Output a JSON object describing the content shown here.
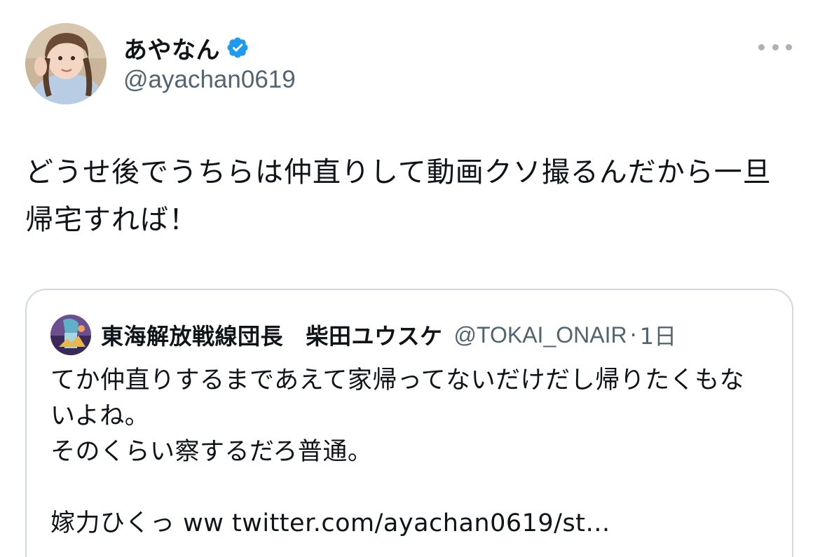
{
  "author": {
    "display_name": "あやなん",
    "handle": "@ayachan0619",
    "verified": true,
    "verified_color": "#1d9bf0"
  },
  "menu": {
    "icon": "more-horizontal-icon"
  },
  "tweet": {
    "text": "どうせ後でうちらは仲直りして動画クソ撮るんだから一旦\n帰宅すれば！"
  },
  "quote": {
    "display_name": "東海解放戦線団長　柴田ユウスケ",
    "handle": "@TOKAI_ONAIR",
    "separator": "·",
    "time": "1日",
    "text_lines": "てか仲直りするまであえて家帰ってないだけだし帰りたくもな\nいよね。\nそのくらい察するだろ普通。\n\n嫁力ひくっ ww ",
    "link": "twitter.com/ayachan0619/st…"
  }
}
